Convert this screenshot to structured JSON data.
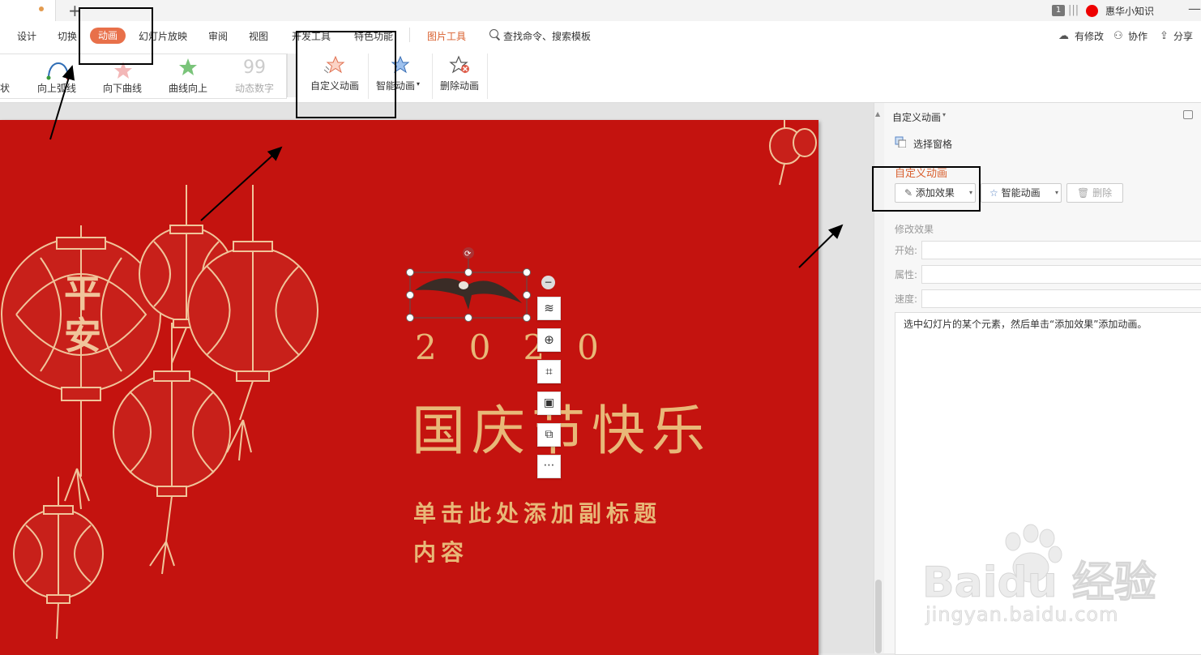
{
  "titlebar": {
    "tab_plus": "+",
    "page_count": "1",
    "separator": "|||",
    "user_name": "惠华小知识",
    "minimize": "—"
  },
  "menu": {
    "items": [
      "设计",
      "切换",
      "动画",
      "幻灯片放映",
      "审阅",
      "视图",
      "开发工具",
      "特色功能"
    ],
    "active": "动画",
    "picture_tools": "图片工具",
    "search": "查找命令、搜索模板",
    "right_tools": [
      "有修改",
      "协作",
      "分享"
    ]
  },
  "ribbon": {
    "gallery": [
      "状",
      "向上弧线",
      "向下曲线",
      "曲线向上",
      "动态数字"
    ],
    "custom_animation": "自定义动画",
    "smart_animation": "智能动画",
    "delete_animation": "删除动画"
  },
  "slide": {
    "lantern_text": "平安",
    "year": "2020",
    "title": "国庆节快乐",
    "subtitle_line1": "单击此处添加副标题",
    "subtitle_line2": "内容"
  },
  "pane": {
    "title": "自定义动画",
    "select_pane": "选择窗格",
    "heading": "自定义动画",
    "add_effect": "添加效果",
    "smart_animation": "智能动画",
    "delete": "删除",
    "modify_heading": "修改效果",
    "start_label": "开始:",
    "property_label": "属性:",
    "speed_label": "速度:",
    "hint": "选中幻灯片的某个元素，然后单击“添加效果”添加动画。"
  },
  "watermark": {
    "brand": "Baidu 经验",
    "url": "jingyan.baidu.com"
  },
  "colors": {
    "accent": "#e8704a",
    "slide_bg": "#c4130f",
    "gold": "#e8b878",
    "pane_heading": "#d9602f"
  }
}
